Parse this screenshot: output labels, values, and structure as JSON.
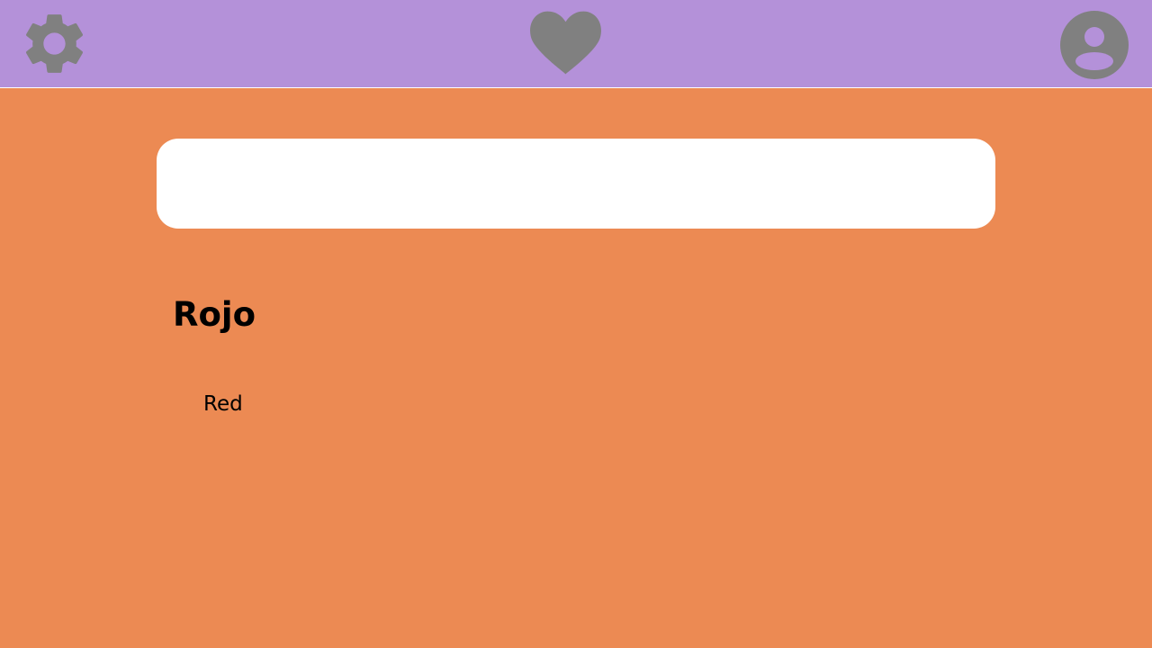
{
  "topbar": {
    "background": "#B491D9",
    "icons": {
      "left": "gear-icon",
      "center": "heart-icon",
      "right": "account-circle-icon"
    },
    "icon_color": "#808080"
  },
  "search": {
    "value": "",
    "placeholder": ""
  },
  "word": {
    "term": "Rojo",
    "translation": "Red"
  },
  "theme": {
    "background": "#EC8A53",
    "card": "#FFFFFF"
  }
}
